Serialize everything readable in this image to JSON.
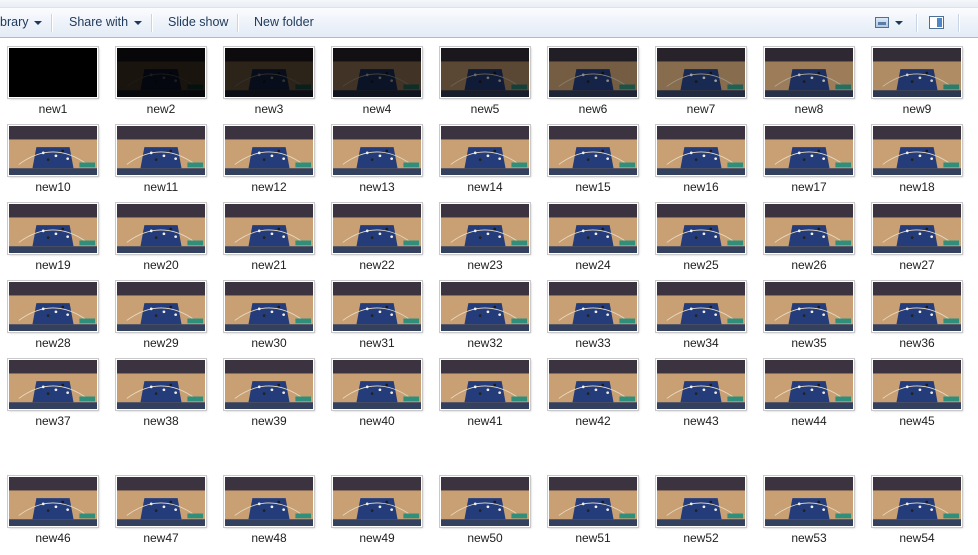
{
  "toolbar": {
    "library_label": "brary",
    "share_label": "Share with",
    "slideshow_label": "Slide show",
    "newfolder_label": "New folder"
  },
  "files": [
    {
      "name": "new1",
      "dim": 1.0
    },
    {
      "name": "new2",
      "dim": 0.88
    },
    {
      "name": "new3",
      "dim": 0.78
    },
    {
      "name": "new4",
      "dim": 0.68
    },
    {
      "name": "new5",
      "dim": 0.55
    },
    {
      "name": "new6",
      "dim": 0.42
    },
    {
      "name": "new7",
      "dim": 0.32
    },
    {
      "name": "new8",
      "dim": 0.22
    },
    {
      "name": "new9",
      "dim": 0.12
    },
    {
      "name": "new10",
      "dim": 0
    },
    {
      "name": "new11",
      "dim": 0
    },
    {
      "name": "new12",
      "dim": 0
    },
    {
      "name": "new13",
      "dim": 0
    },
    {
      "name": "new14",
      "dim": 0
    },
    {
      "name": "new15",
      "dim": 0
    },
    {
      "name": "new16",
      "dim": 0
    },
    {
      "name": "new17",
      "dim": 0
    },
    {
      "name": "new18",
      "dim": 0
    },
    {
      "name": "new19",
      "dim": 0
    },
    {
      "name": "new20",
      "dim": 0
    },
    {
      "name": "new21",
      "dim": 0
    },
    {
      "name": "new22",
      "dim": 0
    },
    {
      "name": "new23",
      "dim": 0
    },
    {
      "name": "new24",
      "dim": 0
    },
    {
      "name": "new25",
      "dim": 0
    },
    {
      "name": "new26",
      "dim": 0
    },
    {
      "name": "new27",
      "dim": 0
    },
    {
      "name": "new28",
      "dim": 0
    },
    {
      "name": "new29",
      "dim": 0
    },
    {
      "name": "new30",
      "dim": 0
    },
    {
      "name": "new31",
      "dim": 0
    },
    {
      "name": "new32",
      "dim": 0
    },
    {
      "name": "new33",
      "dim": 0
    },
    {
      "name": "new34",
      "dim": 0
    },
    {
      "name": "new35",
      "dim": 0
    },
    {
      "name": "new36",
      "dim": 0
    },
    {
      "name": "new37",
      "dim": 0
    },
    {
      "name": "new38",
      "dim": 0
    },
    {
      "name": "new39",
      "dim": 0
    },
    {
      "name": "new40",
      "dim": 0
    },
    {
      "name": "new41",
      "dim": 0
    },
    {
      "name": "new42",
      "dim": 0
    },
    {
      "name": "new43",
      "dim": 0
    },
    {
      "name": "new44",
      "dim": 0
    },
    {
      "name": "new45",
      "dim": 0
    },
    {
      "name": "new46",
      "dim": 0
    },
    {
      "name": "new47",
      "dim": 0
    },
    {
      "name": "new48",
      "dim": 0
    },
    {
      "name": "new49",
      "dim": 0
    },
    {
      "name": "new50",
      "dim": 0
    },
    {
      "name": "new51",
      "dim": 0
    },
    {
      "name": "new52",
      "dim": 0
    },
    {
      "name": "new53",
      "dim": 0
    },
    {
      "name": "new54",
      "dim": 0
    }
  ],
  "colors": {
    "toolbar_text": "#1e395b",
    "court_wood": "#c9a073",
    "paint_blue": "#243d7a",
    "crowd_dark": "#2a2430"
  },
  "icons": [
    "view-options-icon",
    "chevron-down-icon",
    "preview-pane-icon"
  ]
}
